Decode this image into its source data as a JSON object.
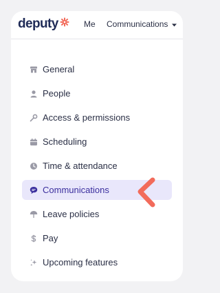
{
  "header": {
    "logo_text": "deputy",
    "nav_me": "Me",
    "nav_communications": "Communications"
  },
  "menu": {
    "items": [
      {
        "label": "General",
        "icon": "storefront-icon"
      },
      {
        "label": "People",
        "icon": "person-icon"
      },
      {
        "label": "Access & permissions",
        "icon": "key-icon"
      },
      {
        "label": "Scheduling",
        "icon": "calendar-icon"
      },
      {
        "label": "Time & attendance",
        "icon": "clock-icon"
      },
      {
        "label": "Communications",
        "icon": "chat-bubble-icon",
        "active": true
      },
      {
        "label": "Leave policies",
        "icon": "umbrella-icon"
      },
      {
        "label": "Pay",
        "icon": "dollar-icon"
      },
      {
        "label": "Upcoming features",
        "icon": "sparkle-icon"
      }
    ]
  },
  "colors": {
    "brand_navy": "#1f2b57",
    "brand_accent": "#f26b5b",
    "active_bg": "#e9e7fb",
    "active_text": "#3b2f9e",
    "icon_gray": "#9a9aa6"
  }
}
